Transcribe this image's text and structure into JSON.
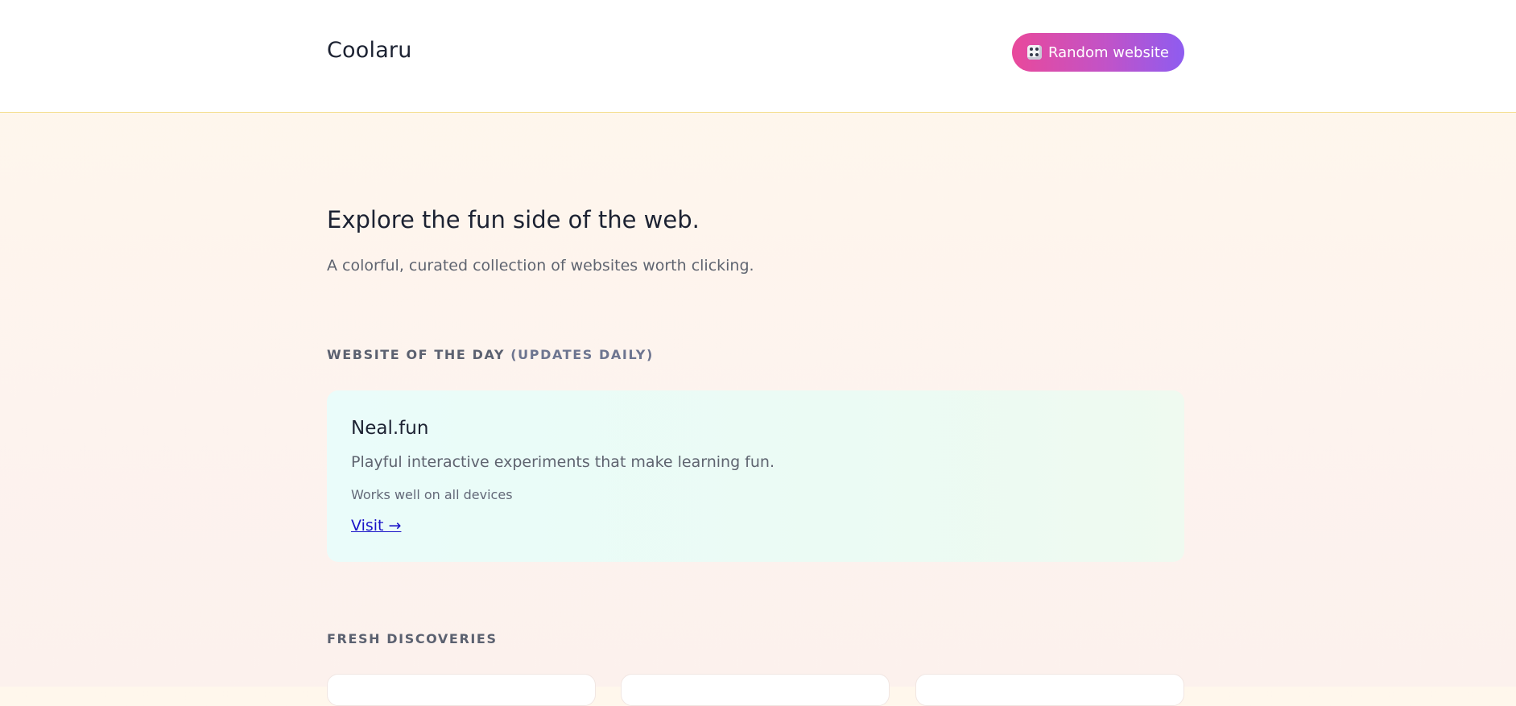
{
  "header": {
    "brand": "Coolaru",
    "random_button": {
      "label": "Random website",
      "icon": "dice-icon"
    }
  },
  "hero": {
    "title": "Explore the fun side of the web.",
    "subtitle": "A colorful, curated collection of websites worth clicking."
  },
  "website_of_the_day": {
    "label": "WEBSITE OF THE DAY",
    "note": "(UPDATES DAILY)",
    "site": {
      "name": "Neal.fun",
      "description": "Playful interactive experiments that make learning fun.",
      "compatibility": "Works well on all devices",
      "visit_label": "Visit →"
    }
  },
  "fresh_discoveries": {
    "label": "FRESH DISCOVERIES"
  },
  "colors": {
    "button_gradient_start": "#e9499b",
    "button_gradient_end": "#8e5cf0",
    "link": "#1a13c8",
    "header_border": "#f4dd8a"
  }
}
